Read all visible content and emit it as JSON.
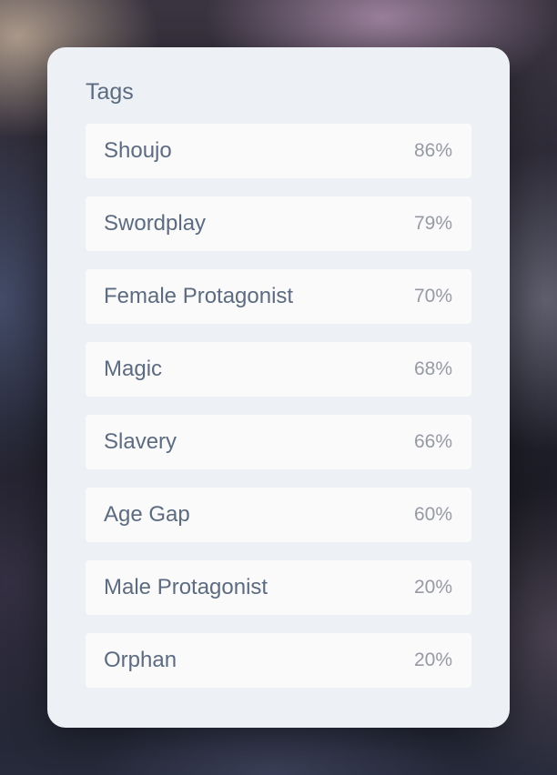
{
  "card": {
    "title": "Tags"
  },
  "tags": [
    {
      "name": "Shoujo",
      "percent": "86%"
    },
    {
      "name": "Swordplay",
      "percent": "79%"
    },
    {
      "name": "Female Protagonist",
      "percent": "70%"
    },
    {
      "name": "Magic",
      "percent": "68%"
    },
    {
      "name": "Slavery",
      "percent": "66%"
    },
    {
      "name": "Age Gap",
      "percent": "60%"
    },
    {
      "name": "Male Protagonist",
      "percent": "20%"
    },
    {
      "name": "Orphan",
      "percent": "20%"
    }
  ],
  "colors": {
    "card_background": "#edf1f6",
    "row_background": "#fafafa",
    "tag_text": "#5c6b80",
    "percent_text": "#969aa3"
  }
}
